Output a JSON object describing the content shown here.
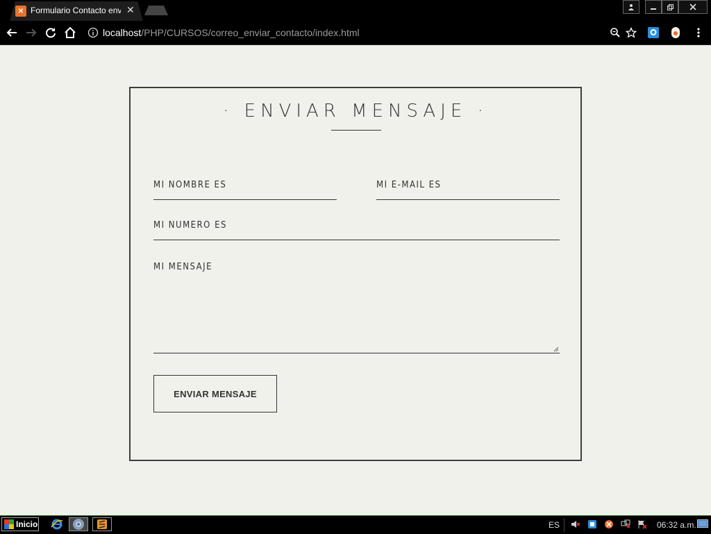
{
  "browser": {
    "tab_title": "Formulario Contacto enviar",
    "tab_favicon": "xampp-icon",
    "url_host": "localhost",
    "url_path": "/PHP/CURSOS/correo_enviar_contacto/index.html"
  },
  "form": {
    "title": "· ENVIAR MENSAJE ·",
    "name_label": "MI NOMBRE ES",
    "email_label": "MI E-MAIL ES",
    "phone_label": "MI NUMERO ES",
    "message_label": "MI MENSAJE",
    "submit_label": "ENVIAR MENSAJE"
  },
  "taskbar": {
    "start_label": "Inicio",
    "language": "ES",
    "clock": "06:32 a.m."
  }
}
